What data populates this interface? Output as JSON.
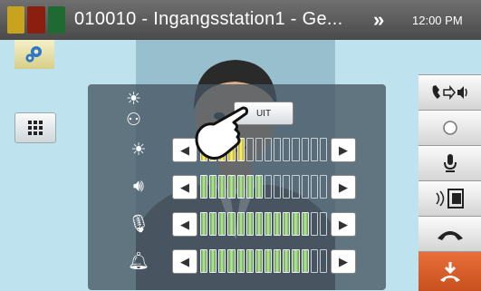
{
  "header": {
    "title": "010010 - Ingangsstation1 - Ge...",
    "time": "12:00 PM",
    "status_colors": [
      "#c8a41e",
      "#8a1f10",
      "#1f6a30"
    ]
  },
  "popup": {
    "button_label": "UIT"
  },
  "controls": [
    {
      "name": "brightness",
      "icon": "sun-icon",
      "level_fraction": 0.36,
      "accent": "#e8e13a"
    },
    {
      "name": "speaker-volume",
      "icon": "speaker-icon",
      "level_fraction": 0.5,
      "accent": "#7fbf5b"
    },
    {
      "name": "mic-volume",
      "icon": "microphone-icon",
      "level_fraction": 0.86,
      "accent": "#7fbf5b"
    },
    {
      "name": "ringtone-volume",
      "icon": "bell-icon",
      "level_fraction": 0.86,
      "accent": "#7fbf5b"
    }
  ],
  "sidebar_icons": [
    "call-transfer-icon",
    "record-icon",
    "microphone-icon",
    "door-release-icon",
    "hangup-icon",
    "end-call-icon"
  ]
}
